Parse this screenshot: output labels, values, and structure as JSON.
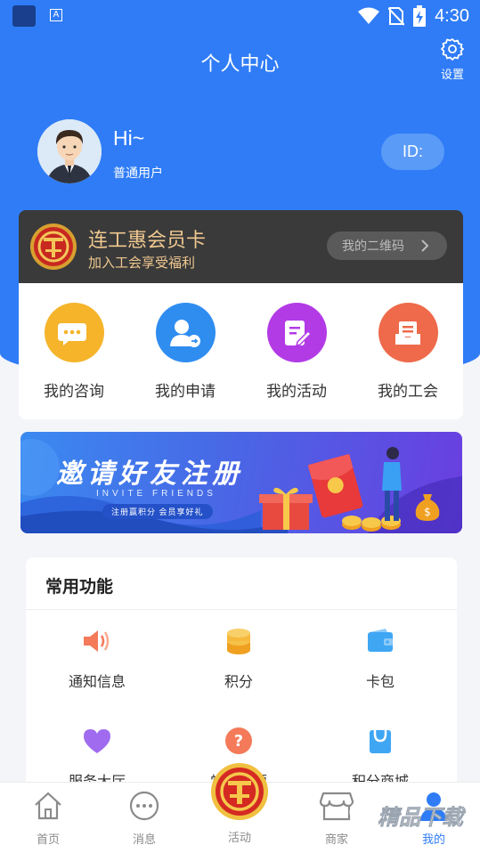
{
  "statusbar": {
    "time": "4:30",
    "a_label": "A"
  },
  "header": {
    "title": "个人中心",
    "settings_label": "设置"
  },
  "profile": {
    "greeting": "Hi~",
    "user_type": "普通用户",
    "id_label": "ID:"
  },
  "member_card": {
    "title": "连工惠会员卡",
    "subtitle": "加入工会享受福利",
    "qr_button": "我的二维码"
  },
  "quick_actions": [
    {
      "label": "我的咨询",
      "icon": "chat-bubbles-icon",
      "color": "#f5b42a"
    },
    {
      "label": "我的申请",
      "icon": "user-apply-icon",
      "color": "#2f8df0"
    },
    {
      "label": "我的活动",
      "icon": "edit-note-icon",
      "color": "#b23be6"
    },
    {
      "label": "我的工会",
      "icon": "inbox-tray-icon",
      "color": "#ee6a4a"
    }
  ],
  "banner": {
    "title": "邀请好友注册",
    "subtitle_en": "INVITE FRIENDS",
    "pill": "注册赢积分 会员享好礼"
  },
  "functions": {
    "title": "常用功能",
    "items": [
      {
        "label": "通知信息",
        "icon": "speaker-icon",
        "color": "#f47a5a"
      },
      {
        "label": "积分",
        "icon": "coin-stack-icon",
        "color": "#f6b93b"
      },
      {
        "label": "卡包",
        "icon": "wallet-icon",
        "color": "#3fa6f4"
      },
      {
        "label": "服务大厅",
        "icon": "heart-icon",
        "color": "#a06bef"
      },
      {
        "label": "常见问题",
        "icon": "question-icon",
        "color": "#f47a5a"
      },
      {
        "label": "积分商城",
        "icon": "shopping-bag-icon",
        "color": "#3fa6f4"
      }
    ]
  },
  "tabbar": {
    "items": [
      {
        "label": "首页",
        "icon": "home-icon"
      },
      {
        "label": "消息",
        "icon": "message-icon"
      },
      {
        "label": "活动",
        "icon": "union-logo-icon"
      },
      {
        "label": "商家",
        "icon": "store-icon"
      },
      {
        "label": "我的",
        "icon": "user-icon",
        "active": true
      }
    ],
    "accent": "#2f7cf6"
  },
  "watermark": {
    "text": "精品下载"
  }
}
